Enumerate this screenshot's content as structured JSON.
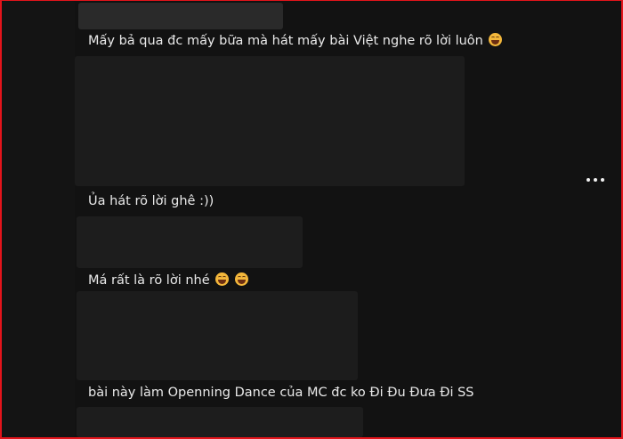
{
  "comments": [
    {
      "text": "Mấy bả qua đc mấy bữa mà hát mấy bài Việt nghe rõ lời luôn",
      "emoji": "grinning-squint-sweat-icon"
    },
    {
      "text": "Ủa hát rõ lời ghê :))"
    },
    {
      "text": "Má rất là rõ lời nhé",
      "emoji": "grinning-squint-sweat-icon"
    },
    {
      "text": "bài này làm Openning Dance của MC đc ko Đi Đu Đưa Đi SS"
    }
  ],
  "menu": {
    "icon": "more-options-icon"
  },
  "colors": {
    "border": "#e3141b",
    "background": "#121212",
    "text": "#e9e9e9"
  }
}
